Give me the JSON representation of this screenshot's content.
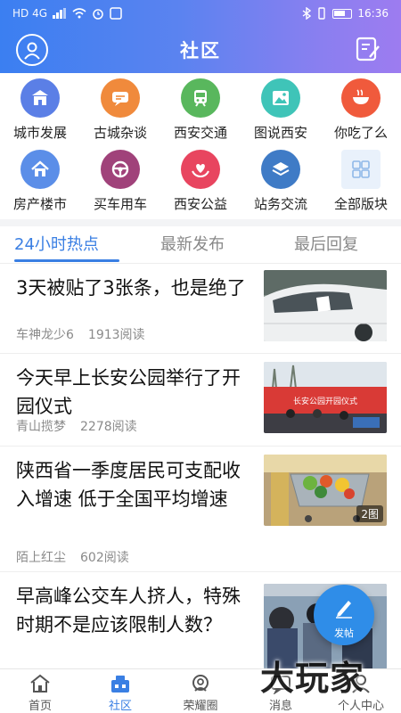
{
  "status_bar": {
    "left": "HD 4G",
    "time": "16:36"
  },
  "header": {
    "title": "社区"
  },
  "categories": [
    {
      "label": "城市发展",
      "icon": "city-gate-icon",
      "color": "#5b7fe6"
    },
    {
      "label": "古城杂谈",
      "icon": "chat-bubble-icon",
      "color": "#f08a3c"
    },
    {
      "label": "西安交通",
      "icon": "train-icon",
      "color": "#59b75d"
    },
    {
      "label": "图说西安",
      "icon": "picture-icon",
      "color": "#3fc4b8"
    },
    {
      "label": "你吃了么",
      "icon": "bowl-icon",
      "color": "#f05a3c"
    },
    {
      "label": "房产楼市",
      "icon": "house-icon",
      "color": "#5b8ee8"
    },
    {
      "label": "买车用车",
      "icon": "steering-wheel-icon",
      "color": "#a0427a"
    },
    {
      "label": "西安公益",
      "icon": "heart-hands-icon",
      "color": "#e8455f"
    },
    {
      "label": "站务交流",
      "icon": "layers-icon",
      "color": "#3f7bc6"
    },
    {
      "label": "全部版块",
      "icon": "grid-icon",
      "color": "#8fb8e8"
    }
  ],
  "tabs": [
    "24小时热点",
    "最新发布",
    "最后回复"
  ],
  "feed": [
    {
      "title": "3天被贴了3张条，也是绝了",
      "author": "车神龙少6",
      "reads": "1913阅读",
      "image_count": ""
    },
    {
      "title": "今天早上长安公园举行了开园仪式",
      "author": "青山揽梦",
      "reads": "2278阅读",
      "image_count": ""
    },
    {
      "title": "陕西省一季度居民可支配收入增速 低于全国平均增速",
      "author": "陌上红尘",
      "reads": "602阅读",
      "image_count": "2图"
    },
    {
      "title": "早高峰公交车人挤人，特殊时期不是应该限制人数？",
      "author": "",
      "reads": "",
      "image_count": ""
    }
  ],
  "thumb_banner_text": "长安公园开园仪式",
  "fab": {
    "label": "发帖"
  },
  "bottom_nav": [
    {
      "label": "首页",
      "icon": "home-icon"
    },
    {
      "label": "社区",
      "icon": "community-icon"
    },
    {
      "label": "荣耀圈",
      "icon": "honor-circle-icon"
    },
    {
      "label": "消息",
      "icon": "message-icon"
    },
    {
      "label": "个人中心",
      "icon": "person-icon"
    }
  ],
  "watermark": "大玩家",
  "colors": {
    "accent": "#3a7fe3",
    "header_start": "#3b7ff1",
    "header_end": "#9d7cf0"
  }
}
